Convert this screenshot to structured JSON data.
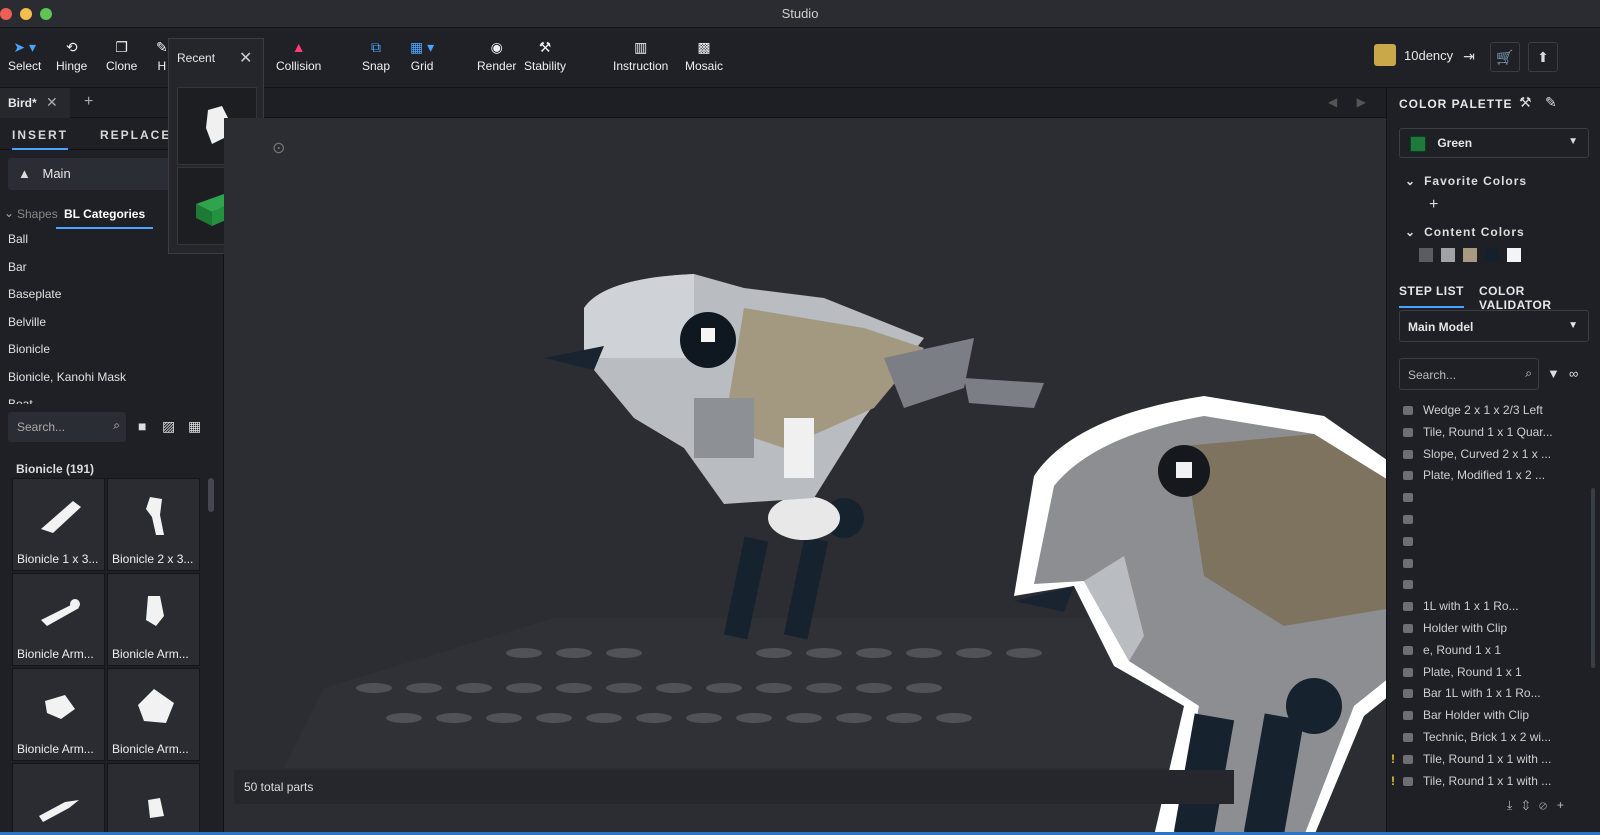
{
  "window": {
    "title": "Studio"
  },
  "toolbar": {
    "tools": [
      {
        "label": "Select",
        "icon": "cursor-icon"
      },
      {
        "label": "Hinge",
        "icon": "hinge-icon"
      },
      {
        "label": "Clone",
        "icon": "clone-icon"
      },
      {
        "label": "H",
        "icon": "hide-icon"
      },
      {
        "label": "Collision",
        "icon": "collision-icon"
      },
      {
        "label": "Snap",
        "icon": "snap-icon"
      },
      {
        "label": "Grid",
        "icon": "grid-icon"
      },
      {
        "label": "Render",
        "icon": "camera-icon"
      },
      {
        "label": "Stability",
        "icon": "stability-icon"
      },
      {
        "label": "Instruction",
        "icon": "instruction-icon"
      },
      {
        "label": "Mosaic",
        "icon": "mosaic-icon"
      }
    ],
    "user": {
      "name": "10dency"
    }
  },
  "tabs": {
    "document": "Bird*"
  },
  "left_panel": {
    "tab_insert": "INSERT",
    "tab_replace": "REPLACE",
    "palette": "Main",
    "cat_shapes": "Shapes",
    "cat_bl": "BL Categories",
    "categories": [
      "Ball",
      "Bar",
      "Baseplate",
      "Belville",
      "Bionicle",
      "Bionicle, Kanohi Mask",
      "Boat"
    ],
    "search_placeholder": "Search...",
    "group_title": "Bionicle (191)",
    "parts": [
      "Bionicle 1 x 3...",
      "Bionicle 2 x 3...",
      "Bionicle Arm...",
      "Bionicle Arm...",
      "Bionicle Arm...",
      "Bionicle Arm...",
      "",
      ""
    ]
  },
  "recent": {
    "title": "Recent"
  },
  "viewport": {
    "status": "50 total parts"
  },
  "right_panel": {
    "header": "COLOR PALETTE",
    "selected_color": "Green",
    "favorite_colors": "Favorite Colors",
    "content_colors": "Content Colors",
    "content_swatches": [
      "#5a5c60",
      "#a0a2a6",
      "#a89a80",
      "#14202c",
      "#f4f4f4"
    ],
    "tab_step_list": "STEP LIST",
    "tab_color_validator": "COLOR VALIDATOR",
    "model": "Main Model",
    "search_placeholder": "Search...",
    "steps": [
      {
        "label": "Wedge 2 x 1 x 2/3 Left",
        "warn": false
      },
      {
        "label": "Tile, Round 1 x 1 Quar...",
        "warn": false
      },
      {
        "label": "Slope, Curved 2 x 1 x ...",
        "warn": false
      },
      {
        "label": "Plate, Modified 1 x 2 ...",
        "warn": false
      },
      {
        "label": "",
        "warn": false
      },
      {
        "label": "",
        "warn": false
      },
      {
        "label": "",
        "warn": false
      },
      {
        "label": "",
        "warn": false
      },
      {
        "label": "",
        "warn": false
      },
      {
        "label": "1L with 1 x 1 Ro...",
        "warn": false
      },
      {
        "label": "Holder with Clip",
        "warn": false
      },
      {
        "label": "e, Round 1 x 1",
        "warn": false
      },
      {
        "label": "Plate, Round 1 x 1",
        "warn": false
      },
      {
        "label": "Bar   1L with 1 x 1 Ro...",
        "warn": false
      },
      {
        "label": "Bar Holder with Clip",
        "warn": false
      },
      {
        "label": "Technic, Brick 1 x 2 wi...",
        "warn": false
      },
      {
        "label": "Tile, Round 1 x 1 with ...",
        "warn": true
      },
      {
        "label": "Tile, Round 1 x 1 with ...",
        "warn": true
      }
    ]
  }
}
